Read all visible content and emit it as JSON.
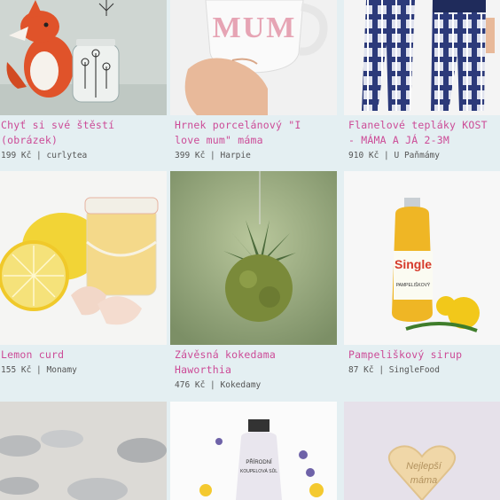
{
  "products": [
    {
      "title": "Chyť si své štěstí\n(obrázek)",
      "price": "199 Kč",
      "seller": "curlytea",
      "image": "fox-illustration"
    },
    {
      "title": "Hrnek porcelánový \"I\nlove mum\" máma",
      "price": "399 Kč",
      "seller": "Harpie",
      "image": "mum-mug"
    },
    {
      "title": "Flanelové tepláky KOST\n- MÁMA A JÁ 2-3M",
      "price": "910 Kč",
      "seller": "U Paňmámy",
      "image": "plaid-pants"
    },
    {
      "title": "Lemon curd",
      "price": "155 Kč",
      "seller": "Monamy",
      "image": "lemon-curd-jar"
    },
    {
      "title": "Závěsná kokedama\nHaworthia",
      "price": "476 Kč",
      "seller": "Kokedamy",
      "image": "kokedama-plant"
    },
    {
      "title": "Pampeliškový sirup",
      "price": "87 Kč",
      "seller": "SingleFood",
      "image": "dandelion-syrup"
    },
    {
      "image": "tin-cans"
    },
    {
      "image": "bath-salt-bottle",
      "label_lines": [
        "PŘÍRODNÍ",
        "KOUPELOVÁ SŮL"
      ]
    },
    {
      "image": "heart-cookie",
      "label_lines": [
        "Nejlepší",
        "máma"
      ]
    }
  ],
  "sep": " | ",
  "mug_text": "MUM",
  "syrup_brand": "Single",
  "syrup_label": "PAMPELIŠKOVÝ"
}
